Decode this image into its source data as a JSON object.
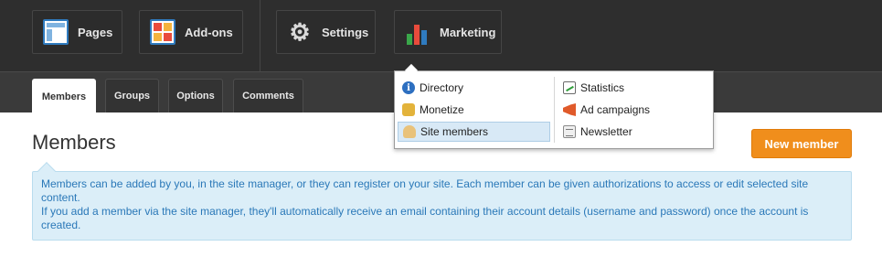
{
  "topnav": {
    "items": [
      {
        "label": "Pages",
        "icon": "pages-icon"
      },
      {
        "label": "Add-ons",
        "icon": "addons-icon"
      },
      {
        "label": "Settings",
        "icon": "gear-icon"
      },
      {
        "label": "Marketing",
        "icon": "bar-chart-icon"
      }
    ]
  },
  "tabs": [
    {
      "label": "Members",
      "active": true
    },
    {
      "label": "Groups",
      "active": false
    },
    {
      "label": "Options",
      "active": false
    },
    {
      "label": "Comments",
      "active": false
    }
  ],
  "dropdown": {
    "left": [
      {
        "label": "Directory",
        "icon": "info-icon"
      },
      {
        "label": "Monetize",
        "icon": "money-icon"
      },
      {
        "label": "Site members",
        "icon": "users-icon",
        "selected": true
      }
    ],
    "right": [
      {
        "label": "Statistics",
        "icon": "statistics-icon"
      },
      {
        "label": "Ad campaigns",
        "icon": "megaphone-icon"
      },
      {
        "label": "Newsletter",
        "icon": "newsletter-icon"
      }
    ]
  },
  "page": {
    "title": "Members",
    "new_member_label": "New member",
    "info_line1": "Members can be added by you, in the site manager, or they can register on your site. Each member can be given authorizations to access or edit selected site content.",
    "info_line2": "If you add a member via the site manager, they'll automatically receive an email containing their account details (username and password) once the account is created."
  },
  "colors": {
    "accent": "#f08e1c",
    "info_background": "#dbeef8",
    "info_text": "#2a78b8"
  }
}
